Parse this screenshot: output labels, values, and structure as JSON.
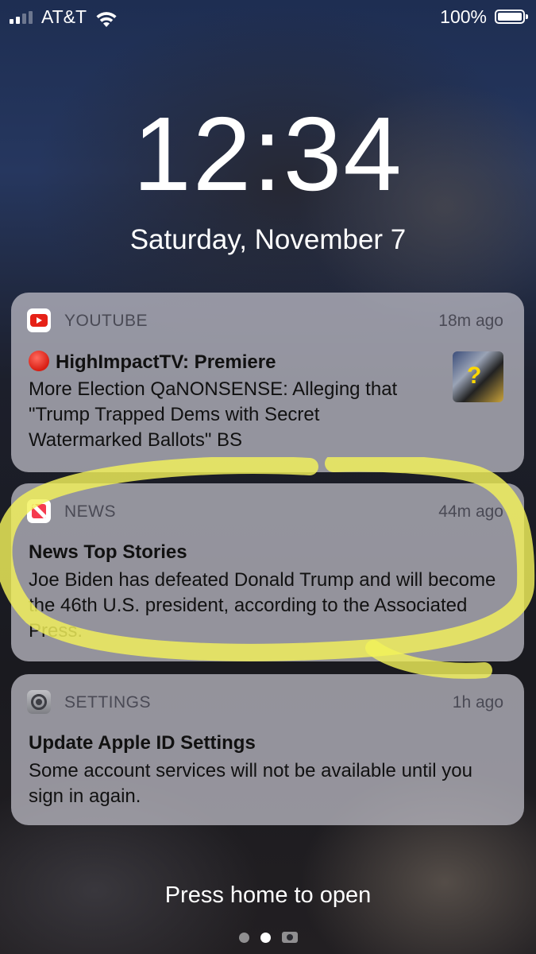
{
  "status_bar": {
    "carrier": "AT&T",
    "battery_percent": "100%",
    "signal_bars": 2,
    "signal_max": 4,
    "battery_level": 1.0,
    "icons": [
      "signal-icon",
      "wifi-icon",
      "battery-icon"
    ]
  },
  "lock_screen": {
    "time": "12:34",
    "date": "Saturday, November 7"
  },
  "notifications": [
    {
      "app": "YOUTUBE",
      "time_ago": "18m ago",
      "icon": "youtube-icon",
      "title": "HighImpactTV: Premiere",
      "body": "More Election QaNONSENSE: Alleging that \"Trump Trapped Dems with Secret Watermarked Ballots\" BS",
      "has_thumbnail": true
    },
    {
      "app": "NEWS",
      "time_ago": "44m ago",
      "icon": "news-icon",
      "title": "News Top Stories",
      "body": "Joe Biden has defeated Donald Trump and will become the 46th U.S. president, according to the Associated Press.",
      "highlighted": true
    },
    {
      "app": "SETTINGS",
      "time_ago": "1h ago",
      "icon": "settings-icon",
      "title": "Update Apple ID Settings",
      "body": "Some account services will not be available until you sign in again."
    }
  ],
  "footer": {
    "hint": "Press home to open",
    "page_count": 2,
    "active_page": 2,
    "camera_icon": "camera-icon"
  },
  "colors": {
    "highlight": "#f3f25a",
    "youtube_red": "#e62117",
    "news_red": "#f53b4f"
  }
}
